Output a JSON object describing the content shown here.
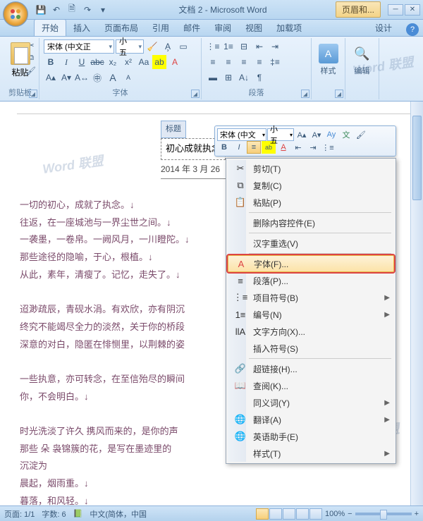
{
  "title": "文档 2 - Microsoft Word",
  "qat": {
    "save": "💾",
    "undo": "↶",
    "redo": "↷",
    "new": "🗎"
  },
  "contextTab": "页眉和...",
  "tabs": {
    "home": "开始",
    "insert": "插入",
    "layout": "页面布局",
    "ref": "引用",
    "mail": "邮件",
    "review": "审阅",
    "view": "视图",
    "addin": "加载项",
    "design": "设计"
  },
  "ribbon": {
    "clipboard": {
      "paste": "粘贴",
      "label": "剪贴板"
    },
    "font": {
      "name": "宋体 (中文正",
      "size": "小五",
      "label": "字体"
    },
    "para": {
      "label": "段落"
    },
    "style": {
      "label": "样式"
    },
    "edit": {
      "label": "编辑"
    }
  },
  "miniToolbar": {
    "font": "宋体 (中文",
    "size": "小五"
  },
  "doc": {
    "headerTag": "标题",
    "titleBox": "初心成就执念",
    "date": "2014 年 3 月 26",
    "p1": "一切的初心，成就了执念。↓",
    "p2": "往返，在一座城池与一界尘世之间。↓",
    "p3": "一袭墨，一卷帛。一阙风月，一川瞪陀。↓",
    "p4": "那些途径的隐喻，于心，根植。↓",
    "p5": "从此，素年，清瘦了。记忆，走失了。↓",
    "p6": "迢渺疏辰，青砚水涓。有欢欣，亦有阴沉",
    "p7": "终究不能竭尽全力的淡然，关于你的桥段",
    "p8": "深意的对白，隐匿在悱恻里，以荆棘的姿",
    "p9": "一些执意，亦可转念，在至信殆尽的瞬间",
    "p10": "你，不会明白。↓",
    "p11": "时光洗淡了许久 携风而来的，是你的声",
    "p12": "那些 朵 袅锦簇的花，是写在墨迹里的",
    "p13": "沉淀为",
    "p14": "晨起，烟雨重。↓",
    "p15": "暮落，和风轻。↓"
  },
  "contextMenu": {
    "cut": "剪切(T)",
    "copy": "复制(C)",
    "paste": "粘贴(P)",
    "deleteContent": "删除内容控件(E)",
    "hanzi": "汉字重选(V)",
    "font": "字体(F)...",
    "para": "段落(P)...",
    "bullets": "项目符号(B)",
    "number": "编号(N)",
    "textdir": "文字方向(X)...",
    "symbol": "插入符号(S)",
    "hyperlink": "超链接(H)...",
    "lookup": "查阅(K)...",
    "synonym": "同义词(Y)",
    "translate": "翻译(A)",
    "eng": "英语助手(E)",
    "styles": "样式(T)"
  },
  "status": {
    "page": "页面: 1/1",
    "words": "字数: 6",
    "lang": "中文(简体，中国",
    "zoom": "100%"
  },
  "watermark": "Word 联盟"
}
